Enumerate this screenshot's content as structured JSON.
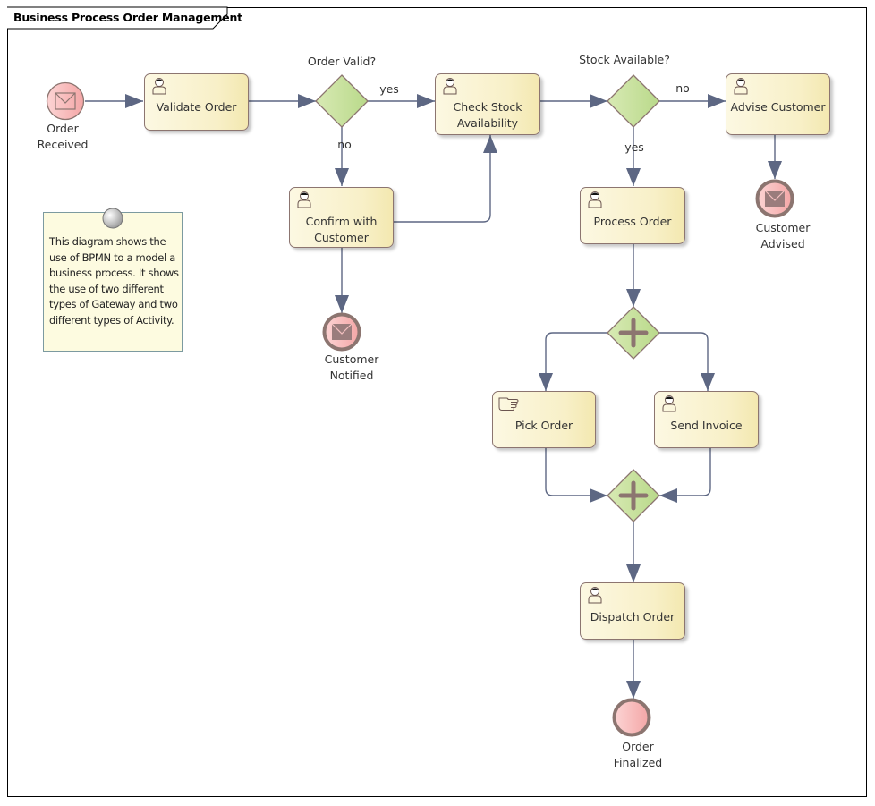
{
  "diagram": {
    "title": "Business Process Order Management",
    "colors": {
      "flow": "#5d6783",
      "task_border": "#8c7570",
      "gateway_fill": "#c5df98",
      "gateway_border": "#8c7570",
      "gateway_marker": "#8c7570",
      "event_fill": "#f8b8b8",
      "event_border": "#8c7570",
      "note_fill": "#fdfbe0",
      "note_border": "#7c9aa0"
    },
    "start_event": {
      "id": "order-received",
      "label_line1": "Order",
      "label_line2": "Received",
      "icon": "envelope-icon"
    },
    "tasks": [
      {
        "id": "validate-order",
        "line1": "Validate Order",
        "line2": "",
        "type": "user-task",
        "icon": "user-icon"
      },
      {
        "id": "check-stock",
        "line1": "Check Stock",
        "line2": "Availability",
        "type": "user-task",
        "icon": "user-icon"
      },
      {
        "id": "advise-customer",
        "line1": "Advise Customer",
        "line2": "",
        "type": "user-task",
        "icon": "user-icon"
      },
      {
        "id": "confirm-customer",
        "line1": "Confirm with",
        "line2": "Customer",
        "type": "user-task",
        "icon": "user-icon"
      },
      {
        "id": "process-order",
        "line1": "Process Order",
        "line2": "",
        "type": "user-task",
        "icon": "user-icon"
      },
      {
        "id": "pick-order",
        "line1": "Pick Order",
        "line2": "",
        "type": "manual-task",
        "icon": "hand-icon"
      },
      {
        "id": "send-invoice",
        "line1": "Send Invoice",
        "line2": "",
        "type": "user-task",
        "icon": "user-icon"
      },
      {
        "id": "dispatch-order",
        "line1": "Dispatch Order",
        "line2": "",
        "type": "user-task",
        "icon": "user-icon"
      }
    ],
    "gateways": [
      {
        "id": "order-valid",
        "type": "exclusive",
        "label": "Order Valid?"
      },
      {
        "id": "stock-available",
        "type": "exclusive",
        "label": "Stock Available?"
      },
      {
        "id": "fork",
        "type": "parallel",
        "label": ""
      },
      {
        "id": "join",
        "type": "parallel",
        "label": ""
      }
    ],
    "end_events": [
      {
        "id": "customer-notified",
        "line1": "Customer",
        "line2": "Notified",
        "icon": "envelope-icon"
      },
      {
        "id": "customer-advised",
        "line1": "Customer",
        "line2": "Advised",
        "icon": "envelope-icon"
      },
      {
        "id": "order-finalized",
        "line1": "Order",
        "line2": "Finalized",
        "icon": "none"
      }
    ],
    "flow_labels": {
      "order_valid_yes": "yes",
      "order_valid_no": "no",
      "stock_no": "no",
      "stock_yes": "yes"
    },
    "flows": [
      {
        "from": "order-received",
        "to": "validate-order",
        "label": ""
      },
      {
        "from": "validate-order",
        "to": "order-valid",
        "label": ""
      },
      {
        "from": "order-valid",
        "to": "check-stock",
        "label": "yes"
      },
      {
        "from": "order-valid",
        "to": "confirm-customer",
        "label": "no"
      },
      {
        "from": "confirm-customer",
        "to": "check-stock",
        "label": ""
      },
      {
        "from": "confirm-customer",
        "to": "customer-notified",
        "label": ""
      },
      {
        "from": "check-stock",
        "to": "stock-available",
        "label": ""
      },
      {
        "from": "stock-available",
        "to": "advise-customer",
        "label": "no"
      },
      {
        "from": "stock-available",
        "to": "process-order",
        "label": "yes"
      },
      {
        "from": "advise-customer",
        "to": "customer-advised",
        "label": ""
      },
      {
        "from": "process-order",
        "to": "fork",
        "label": ""
      },
      {
        "from": "fork",
        "to": "pick-order",
        "label": ""
      },
      {
        "from": "fork",
        "to": "send-invoice",
        "label": ""
      },
      {
        "from": "pick-order",
        "to": "join",
        "label": ""
      },
      {
        "from": "send-invoice",
        "to": "join",
        "label": ""
      },
      {
        "from": "join",
        "to": "dispatch-order",
        "label": ""
      },
      {
        "from": "dispatch-order",
        "to": "order-finalized",
        "label": ""
      }
    ],
    "note": {
      "lines": [
        "This diagram shows the",
        "use of BPMN to a model a",
        "business process.  It shows",
        "the use of two different",
        "types of Gateway and two",
        "different types of Activity."
      ]
    }
  }
}
